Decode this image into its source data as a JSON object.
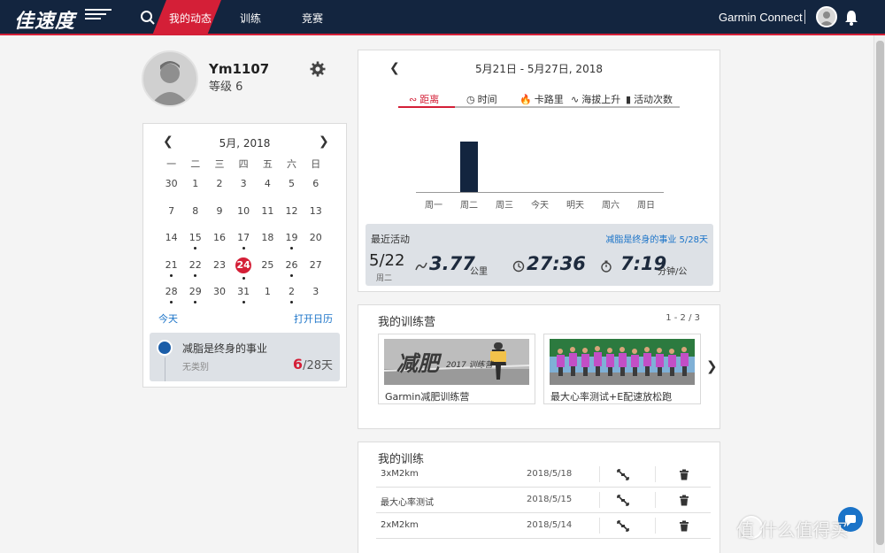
{
  "header": {
    "logo": "佳速度",
    "nav": [
      "我的动态",
      "训练",
      "竞赛"
    ],
    "active_nav": "我的动态",
    "brand": "Garmin Connect"
  },
  "profile": {
    "username": "Ym1107",
    "level": "等级 6"
  },
  "calendar": {
    "title": "5月, 2018",
    "weekdays": [
      "一",
      "二",
      "三",
      "四",
      "五",
      "六",
      "日"
    ],
    "days": [
      {
        "d": "30",
        "dot": false
      },
      {
        "d": "1",
        "dot": false
      },
      {
        "d": "2",
        "dot": false
      },
      {
        "d": "3",
        "dot": false
      },
      {
        "d": "4",
        "dot": false
      },
      {
        "d": "5",
        "dot": false
      },
      {
        "d": "6",
        "dot": false
      },
      {
        "d": "7",
        "dot": false
      },
      {
        "d": "8",
        "dot": false
      },
      {
        "d": "9",
        "dot": false
      },
      {
        "d": "10",
        "dot": false
      },
      {
        "d": "11",
        "dot": false
      },
      {
        "d": "12",
        "dot": false
      },
      {
        "d": "13",
        "dot": false
      },
      {
        "d": "14",
        "dot": false
      },
      {
        "d": "15",
        "dot": true
      },
      {
        "d": "16",
        "dot": false
      },
      {
        "d": "17",
        "dot": true
      },
      {
        "d": "18",
        "dot": false
      },
      {
        "d": "19",
        "dot": true
      },
      {
        "d": "20",
        "dot": false
      },
      {
        "d": "21",
        "dot": true
      },
      {
        "d": "22",
        "dot": true
      },
      {
        "d": "23",
        "dot": false
      },
      {
        "d": "24",
        "dot": true,
        "today": true
      },
      {
        "d": "25",
        "dot": false
      },
      {
        "d": "26",
        "dot": true
      },
      {
        "d": "27",
        "dot": false
      },
      {
        "d": "28",
        "dot": true
      },
      {
        "d": "29",
        "dot": true
      },
      {
        "d": "30",
        "dot": false
      },
      {
        "d": "31",
        "dot": true
      },
      {
        "d": "1",
        "dot": false
      },
      {
        "d": "2",
        "dot": true
      },
      {
        "d": "3",
        "dot": false
      }
    ],
    "today_link": "今天",
    "open_link": "打开日历",
    "campaign": {
      "name": "减脂是终身的事业",
      "sub": "无类别",
      "current": "6",
      "total": "/28天"
    }
  },
  "weekly": {
    "range": "5月21日 - 5月27日, 2018",
    "tabs": [
      "距离",
      "时间",
      "卡路里",
      "海拔上升",
      "活动次数"
    ],
    "active_tab": "距离"
  },
  "chart_data": {
    "type": "bar",
    "categories": [
      "周一",
      "周二",
      "周三",
      "今天",
      "明天",
      "周六",
      "周日"
    ],
    "values": [
      0,
      3.77,
      0,
      0,
      0,
      0,
      0
    ],
    "ylim": [
      0,
      4.2
    ],
    "title": "",
    "xlabel": "",
    "ylabel": ""
  },
  "recent": {
    "title": "最近活动",
    "link": "减脂是终身的事业   5/28天",
    "date": "5/22",
    "dow": "周二",
    "distance": "3.77",
    "distance_unit": "公里",
    "duration": "27:36",
    "pace": "7:19",
    "pace_unit": "分钟/公"
  },
  "camps": {
    "title": "我的训练营",
    "pager": "1 - 2 / 3",
    "items": [
      {
        "caption": "Garmin减肥训练营",
        "img_text": "减肥",
        "img_year": "2017 训练营"
      },
      {
        "caption": "最大心率测试+E配速放松跑"
      }
    ]
  },
  "workouts": {
    "title": "我的训练",
    "rows": [
      {
        "name": "3xM2km",
        "date": "2018/5/18"
      },
      {
        "name": "最大心率测试",
        "date": "2018/5/15"
      },
      {
        "name": "2xM2km",
        "date": "2018/5/14"
      }
    ]
  },
  "watermark": "值 什么值得买",
  "colors": {
    "nav_bg": "#13253f",
    "accent": "#d41f37",
    "link": "#1a73c8"
  }
}
